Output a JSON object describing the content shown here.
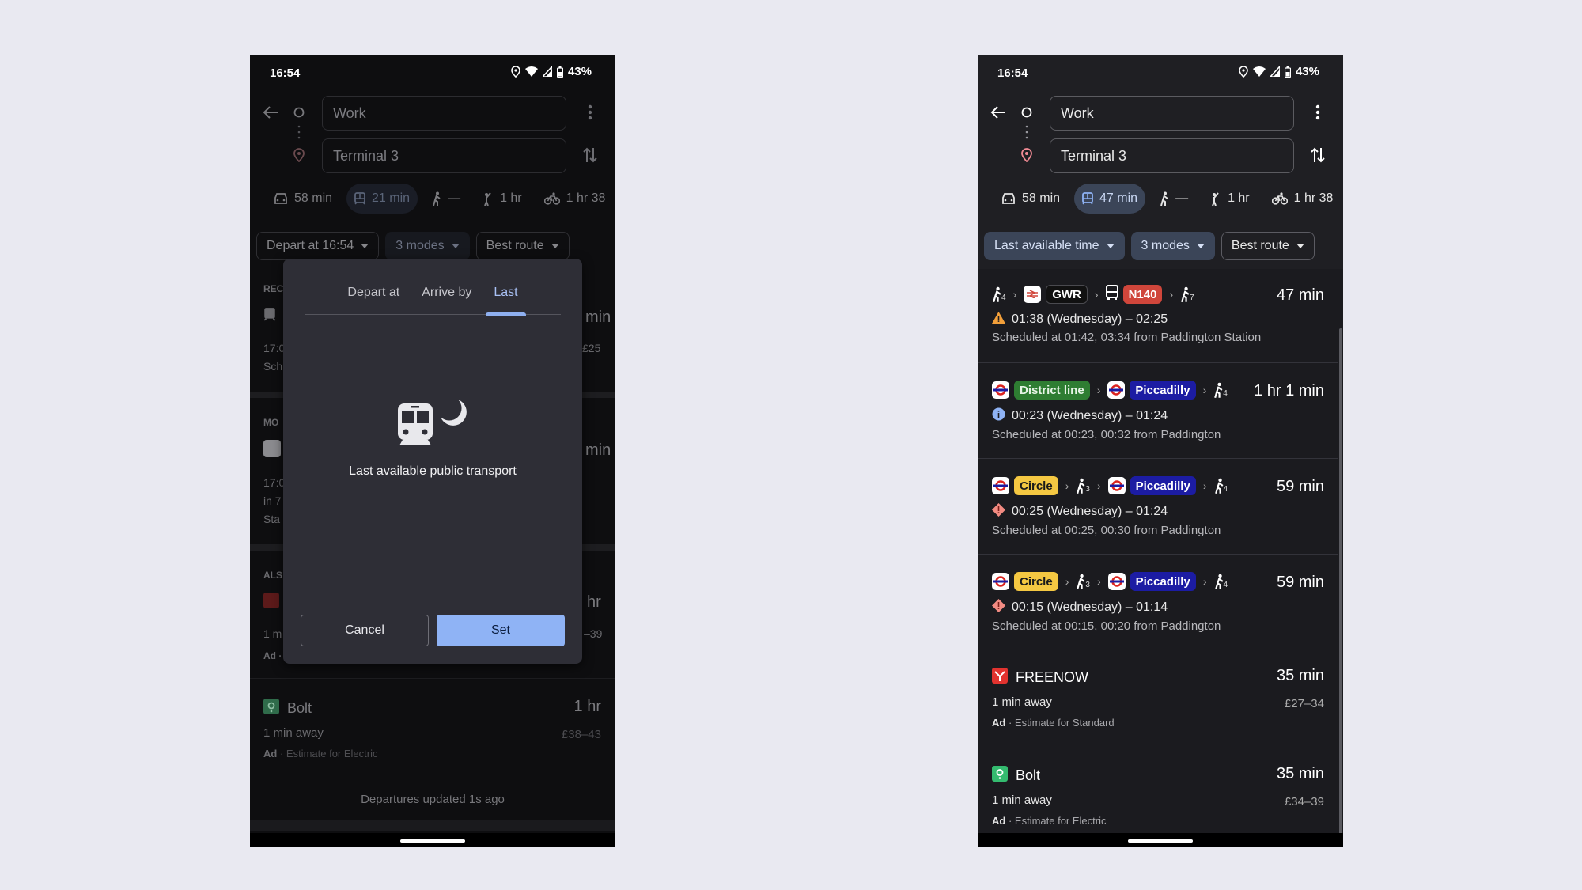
{
  "status_bar": {
    "time": "16:54",
    "battery": "43%"
  },
  "left_screen": {
    "origin_field": {
      "value": "Work"
    },
    "destination_field": {
      "value": "Terminal 3"
    },
    "modes": [
      {
        "icon": "car-icon",
        "label": "58 min",
        "active": false
      },
      {
        "icon": "transit-icon",
        "label": "21 min",
        "active": true
      },
      {
        "icon": "walk-icon",
        "label": "—",
        "active": false
      },
      {
        "icon": "ride-hail-icon",
        "label": "1 hr",
        "active": false
      },
      {
        "icon": "bike-icon",
        "label": "1 hr 38",
        "active": false
      }
    ],
    "chips": [
      {
        "label": "Depart at 16:54",
        "filled": false
      },
      {
        "label": "3 modes",
        "filled": true
      },
      {
        "label": "Best route",
        "filled": false
      }
    ],
    "background_fragments": {
      "section_recommended": "REC",
      "section_more": "MO",
      "section_also": "ALS",
      "row1_time": "17:0",
      "row1_sub": "Sch",
      "row1_dur": "min",
      "row1_price": "£25",
      "row2_time": "17:0",
      "row2_sub1": "in 7",
      "row2_sub2": "Sta",
      "row2_dur": "min",
      "row3_sub": "1 m",
      "row3_ad": "Ad ·",
      "row3_dur": "hr",
      "row3_price": "–39"
    },
    "bolt": {
      "name": "Bolt",
      "duration": "1 hr",
      "eta": "1 min away",
      "price": "£38–43",
      "ad_label": "Ad",
      "ad_text": " · Estimate for Electric"
    },
    "footer": "Departures updated 1s ago",
    "modal": {
      "tabs": [
        {
          "label": "Depart at",
          "active": false
        },
        {
          "label": "Arrive by",
          "active": false
        },
        {
          "label": "Last",
          "active": true
        }
      ],
      "caption": "Last available public transport",
      "cancel_label": "Cancel",
      "set_label": "Set"
    }
  },
  "right_screen": {
    "origin_field": {
      "value": "Work"
    },
    "destination_field": {
      "value": "Terminal 3"
    },
    "modes": [
      {
        "icon": "car-icon",
        "label": "58 min",
        "active": false
      },
      {
        "icon": "transit-icon",
        "label": "47 min",
        "active": true
      },
      {
        "icon": "walk-icon",
        "label": "—",
        "active": false
      },
      {
        "icon": "ride-hail-icon",
        "label": "1 hr",
        "active": false
      },
      {
        "icon": "bike-icon",
        "label": "1 hr 38",
        "active": false
      }
    ],
    "chips": [
      {
        "label": "Last available time",
        "filled": true
      },
      {
        "label": "3 modes",
        "filled": true
      },
      {
        "label": "Best route",
        "filled": false
      }
    ],
    "routes": [
      {
        "duration": "47 min",
        "steps": {
          "walk1": "4",
          "line1": "GWR",
          "line2": "N140",
          "walk2": "7"
        },
        "alert": "warning",
        "times": "01:38 (Wednesday) – 02:25",
        "scheduled": "Scheduled at 01:42, 03:34 from Paddington Station"
      },
      {
        "duration": "1 hr 1 min",
        "steps": {
          "line1": "District line",
          "line2": "Piccadilly",
          "walk2": "4"
        },
        "alert": "info",
        "times": "00:23 (Wednesday) – 01:24",
        "scheduled": "Scheduled at 00:23, 00:32 from Paddington"
      },
      {
        "duration": "59 min",
        "steps": {
          "line1": "Circle",
          "walk1": "3",
          "line2": "Piccadilly",
          "walk2": "4"
        },
        "alert": "disruption",
        "times": "00:25 (Wednesday) – 01:24",
        "scheduled": "Scheduled at 00:25, 00:30 from Paddington"
      },
      {
        "duration": "59 min",
        "steps": {
          "line1": "Circle",
          "walk1": "3",
          "line2": "Piccadilly",
          "walk2": "4"
        },
        "alert": "disruption",
        "times": "00:15 (Wednesday) – 01:14",
        "scheduled": "Scheduled at 00:15, 00:20 from Paddington"
      }
    ],
    "rides": [
      {
        "name": "FREENOW",
        "duration": "35 min",
        "eta": "1 min away",
        "price": "£27–34",
        "ad_label": "Ad",
        "ad_text": " · Estimate for Standard"
      },
      {
        "name": "Bolt",
        "duration": "35 min",
        "eta": "1 min away",
        "price": "£34–39",
        "ad_label": "Ad",
        "ad_text": " · Estimate for Electric"
      }
    ]
  },
  "colors": {
    "page_bg": "#e9e9f1",
    "phone_bg_dark": "#1f1f23",
    "accent_blue": "#8fb3f5",
    "gwr_red": "#d0463b",
    "district_green": "#2e7d32",
    "piccadilly_blue": "#1c1ca3",
    "circle_yellow": "#f5c842",
    "freenow_red": "#e2332f",
    "bolt_green": "#34bb6f"
  }
}
